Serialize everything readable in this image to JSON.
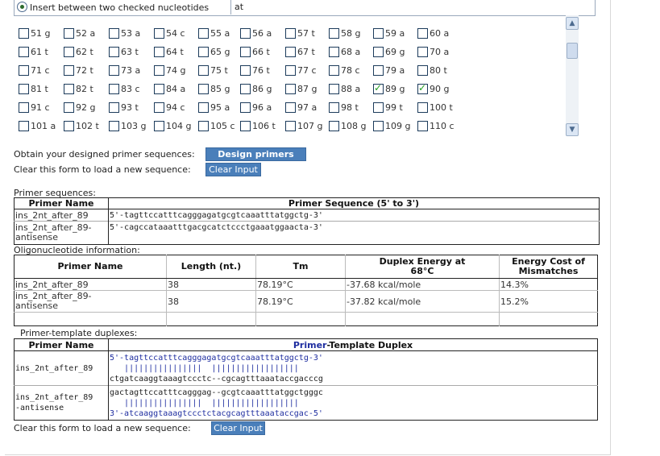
{
  "insert_option": {
    "label": "Insert between two checked nucleotides",
    "value": "at"
  },
  "grid": [
    [
      {
        "label": "51 g",
        "checked": false
      },
      {
        "label": "52 a",
        "checked": false
      },
      {
        "label": "53 a",
        "checked": false
      },
      {
        "label": "54 c",
        "checked": false
      },
      {
        "label": "55 a",
        "checked": false
      },
      {
        "label": "56 a",
        "checked": false
      },
      {
        "label": "57 t",
        "checked": false
      },
      {
        "label": "58 g",
        "checked": false
      },
      {
        "label": "59 a",
        "checked": false
      },
      {
        "label": "60 a",
        "checked": false
      }
    ],
    [
      {
        "label": "61 t",
        "checked": false
      },
      {
        "label": "62 t",
        "checked": false
      },
      {
        "label": "63 t",
        "checked": false
      },
      {
        "label": "64 t",
        "checked": false
      },
      {
        "label": "65 g",
        "checked": false
      },
      {
        "label": "66 t",
        "checked": false
      },
      {
        "label": "67 t",
        "checked": false
      },
      {
        "label": "68 a",
        "checked": false
      },
      {
        "label": "69 g",
        "checked": false
      },
      {
        "label": "70 a",
        "checked": false
      }
    ],
    [
      {
        "label": "71 c",
        "checked": false
      },
      {
        "label": "72 t",
        "checked": false
      },
      {
        "label": "73 a",
        "checked": false
      },
      {
        "label": "74 g",
        "checked": false
      },
      {
        "label": "75 t",
        "checked": false
      },
      {
        "label": "76 t",
        "checked": false
      },
      {
        "label": "77 c",
        "checked": false
      },
      {
        "label": "78 c",
        "checked": false
      },
      {
        "label": "79 a",
        "checked": false
      },
      {
        "label": "80 t",
        "checked": false
      }
    ],
    [
      {
        "label": "81 t",
        "checked": false
      },
      {
        "label": "82 t",
        "checked": false
      },
      {
        "label": "83 c",
        "checked": false
      },
      {
        "label": "84 a",
        "checked": false
      },
      {
        "label": "85 g",
        "checked": false
      },
      {
        "label": "86 g",
        "checked": false
      },
      {
        "label": "87 g",
        "checked": false
      },
      {
        "label": "88 a",
        "checked": false
      },
      {
        "label": "89 g",
        "checked": true
      },
      {
        "label": "90 g",
        "checked": true
      }
    ],
    [
      {
        "label": "91 c",
        "checked": false
      },
      {
        "label": "92 g",
        "checked": false
      },
      {
        "label": "93 t",
        "checked": false
      },
      {
        "label": "94 c",
        "checked": false
      },
      {
        "label": "95 a",
        "checked": false
      },
      {
        "label": "96 a",
        "checked": false
      },
      {
        "label": "97 a",
        "checked": false
      },
      {
        "label": "98 t",
        "checked": false
      },
      {
        "label": "99 t",
        "checked": false
      },
      {
        "label": "100 t",
        "checked": false
      }
    ],
    [
      {
        "label": "101 a",
        "checked": false
      },
      {
        "label": "102 t",
        "checked": false
      },
      {
        "label": "103 g",
        "checked": false
      },
      {
        "label": "104 g",
        "checked": false
      },
      {
        "label": "105 c",
        "checked": false
      },
      {
        "label": "106 t",
        "checked": false
      },
      {
        "label": "107 g",
        "checked": false
      },
      {
        "label": "108 g",
        "checked": false
      },
      {
        "label": "109 g",
        "checked": false
      },
      {
        "label": "110 c",
        "checked": false
      }
    ]
  ],
  "actions": {
    "design_label": "Obtain your designed primer sequences:",
    "design_button": "Design primers",
    "clear_label": "Clear this form to load a new sequence:",
    "clear_button": "Clear Input"
  },
  "primer_sequences": {
    "section_label": "Primer sequences:",
    "headers": [
      "Primer Name",
      "Primer Sequence (5' to 3')"
    ],
    "rows": [
      {
        "name": "ins_2nt_after_89",
        "sequence": "5'-tagttccatttcagggagatgcgtcaaatttatggctg-3'"
      },
      {
        "name_line1": "ins_2nt_after_89-",
        "name_line2": "antisense",
        "sequence": "5'-cagccataaatttgacgcatctccctgaaatggaacta-3'"
      }
    ]
  },
  "oligo": {
    "section_label": "Oligonucleotide information:",
    "headers": {
      "name": "Primer Name",
      "length": "Length (nt.)",
      "tm": "Tm",
      "duplex_line1": "Duplex Energy at",
      "duplex_line2": "68°C",
      "cost_line1": "Energy Cost of",
      "cost_line2": "Mismatches"
    },
    "rows": [
      {
        "name": "ins_2nt_after_89",
        "length": "38",
        "tm": "78.19°C",
        "duplex": "-37.68 kcal/mole",
        "cost": "14.3%"
      },
      {
        "name_line1": "ins_2nt_after_89-",
        "name_line2": "antisense",
        "length": "38",
        "tm": "78.19°C",
        "duplex": "-37.82 kcal/mole",
        "cost": "15.2%"
      }
    ]
  },
  "duplex": {
    "section_label": "Primer-template duplexes:",
    "headers": {
      "name": "Primer Name",
      "dup_prefix": "Primer",
      "dup_suffix": "-Template Duplex"
    },
    "rows": [
      {
        "name": "ins_2nt_after_89",
        "line1": "5'-tagttccatttcagggagatgcgtcaaatttatggctg-3'",
        "line2": "   ||||||||||||||||  ||||||||||||||||||",
        "line3": "ctgatcaaggtaaagtccctc--cgcagtttaaataccgacccg"
      },
      {
        "name_line1": "ins_2nt_after_89",
        "name_line2": "-antisense",
        "line1": "gactagttccatttcagggag--gcgtcaaatttatggctgggc",
        "line2": "   ||||||||||||||||  ||||||||||||||||||",
        "line3": "3'-atcaaggtaaagtccctctacgcagtttaaataccgac-5'"
      }
    ]
  },
  "footer": {
    "clear_label": "Clear this form to load a new sequence:",
    "clear_button": "Clear Input"
  }
}
